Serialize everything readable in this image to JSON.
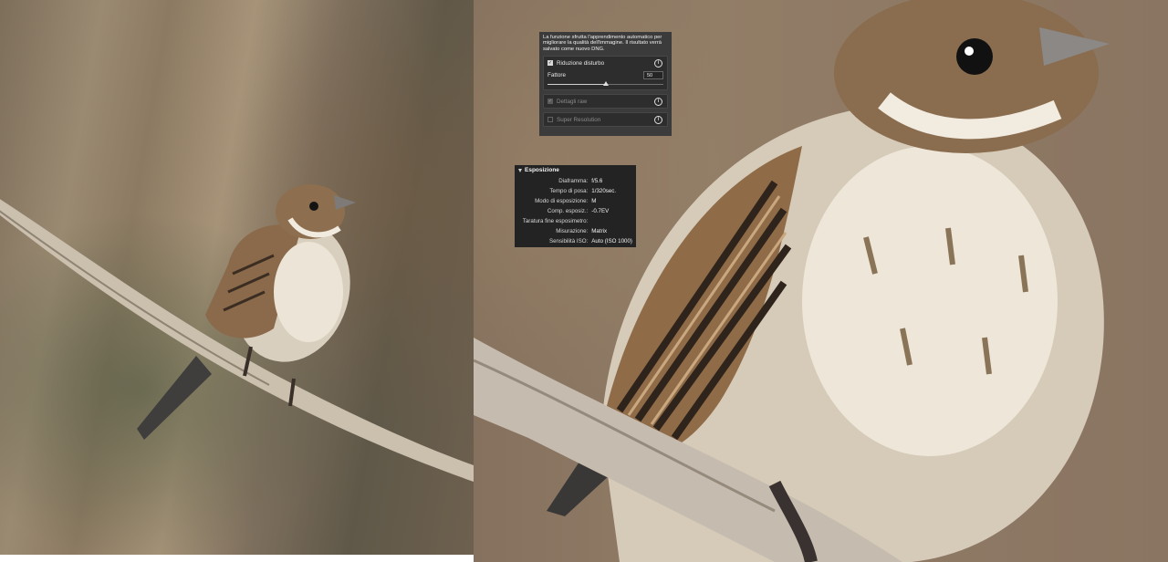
{
  "left_photo": {
    "description_icon": "bird-photo"
  },
  "right_photo": {
    "description_icon": "bird-closeup-photo"
  },
  "enhance_panel": {
    "description": "La funzione sfrutta l'apprendimento automatico per migliorare la qualità dell'immagine. Il risultato verrà salvato come nuovo DNG.",
    "noise_reduction": {
      "label": "Riduzione disturbo",
      "checked": true
    },
    "factor": {
      "label": "Fattore",
      "value": "50",
      "level": 0.5
    },
    "raw_details": {
      "label": "Dettagli raw",
      "checked": true,
      "disabled": true
    },
    "super_resolution": {
      "label": "Super Resolution",
      "checked": false,
      "disabled": true
    },
    "info_icon": "info-icon"
  },
  "exposure_panel": {
    "title": "Esposizione",
    "rows": [
      {
        "key": "Diaframma:",
        "value": "f/5.6"
      },
      {
        "key": "Tempo di posa:",
        "value": "1/320sec."
      },
      {
        "key": "Modo di esposizione:",
        "value": "M"
      },
      {
        "key": "Comp. esposiz.:",
        "value": "-0.7EV"
      },
      {
        "key": "Taratura fine esposimetro:",
        "value": ""
      },
      {
        "key": "Misurazione:",
        "value": "Matrix"
      },
      {
        "key": "Sensibilità ISO:",
        "value": "Auto (ISO 1000)"
      }
    ]
  },
  "colors": {
    "panel_bg": "#3b3b3b",
    "exposure_bg": "#232323",
    "text": "#e8e8e8"
  }
}
